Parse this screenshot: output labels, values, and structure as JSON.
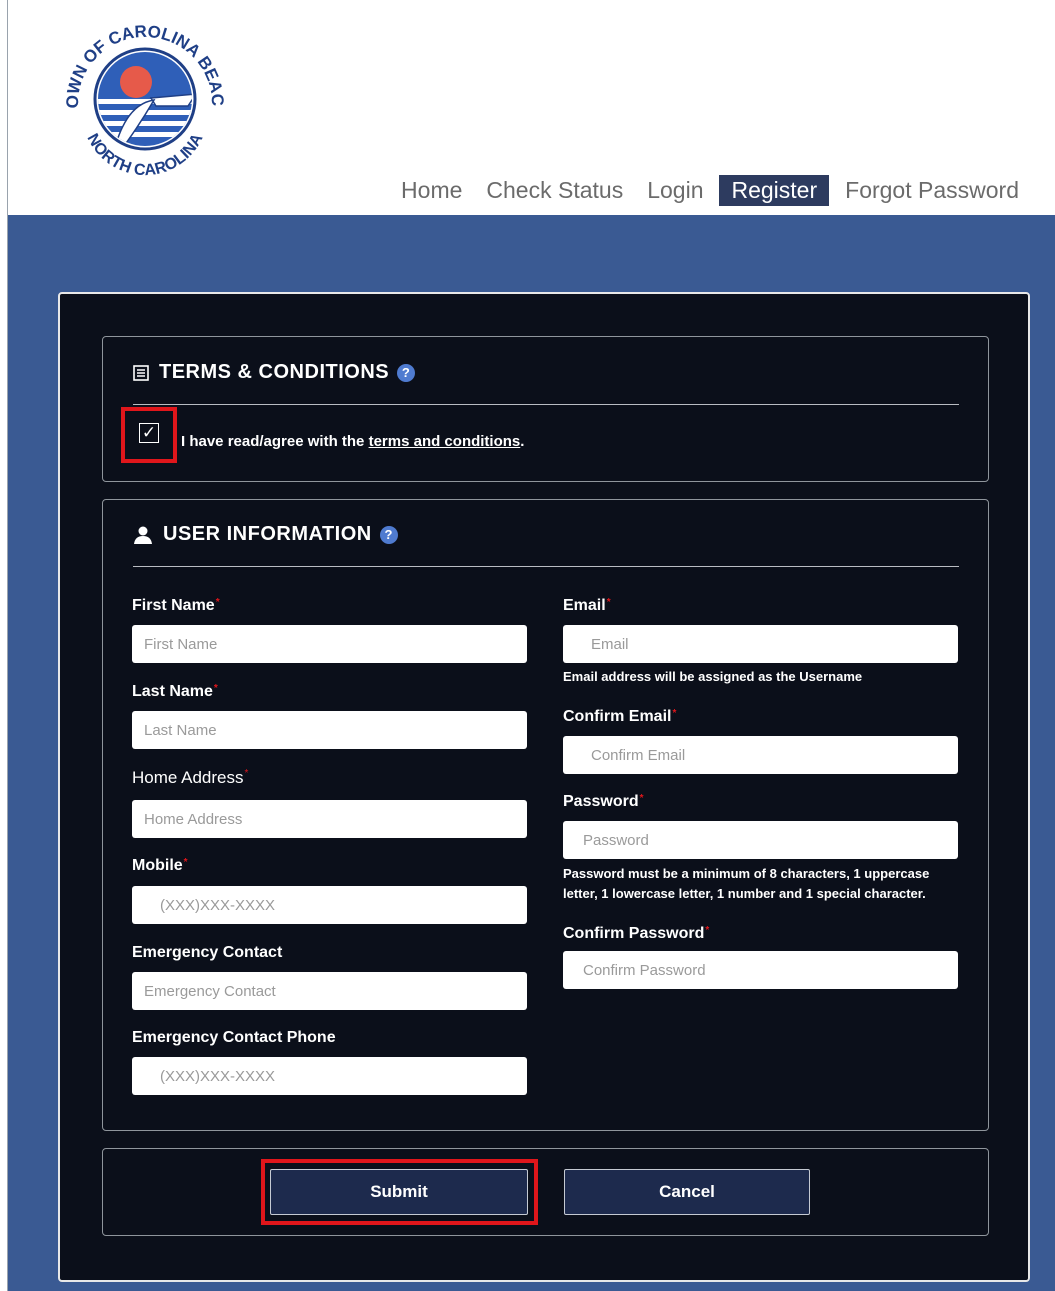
{
  "header": {
    "logo_text": "TOWN OF CAROLINA BEACH NORTH CAROLINA",
    "nav": [
      {
        "label": "Home"
      },
      {
        "label": "Check Status"
      },
      {
        "label": "Login"
      },
      {
        "label": "Register",
        "active": true
      },
      {
        "label": "Forgot Password"
      }
    ]
  },
  "terms": {
    "title": "TERMS & CONDITIONS",
    "checked": true,
    "agree_prefix": "I have read/agree with the",
    "link_text": "terms and conditions",
    "agree_suffix": "."
  },
  "user_info": {
    "title": "USER INFORMATION",
    "required_mark": "*",
    "left": [
      {
        "label": "First Name",
        "required": true,
        "placeholder": "First Name"
      },
      {
        "label": "Last Name",
        "required": true,
        "placeholder": "Last Name"
      },
      {
        "label": "Home Address",
        "required": true,
        "placeholder": "Home Address"
      },
      {
        "label": "Mobile",
        "required": true,
        "placeholder": "(XXX)XXX-XXXX"
      },
      {
        "label": "Emergency Contact",
        "required": false,
        "placeholder": "Emergency Contact"
      },
      {
        "label": "Emergency Contact Phone",
        "required": false,
        "placeholder": "(XXX)XXX-XXXX"
      }
    ],
    "right": [
      {
        "label": "Email",
        "required": true,
        "placeholder": "Email"
      },
      {
        "label": "Confirm Email",
        "required": true,
        "placeholder": "Confirm Email"
      },
      {
        "label": "Password",
        "required": true,
        "placeholder": "Password"
      },
      {
        "label": "Confirm Password",
        "required": true,
        "placeholder": "Confirm Password"
      }
    ],
    "email_hint": "Email address will be assigned as the Username",
    "password_hint_line1": "Password must be a minimum of 8 characters, 1 uppercase",
    "password_hint_line2": "letter, 1 lowercase letter, 1 number and 1 special character."
  },
  "actions": {
    "submit_label": "Submit",
    "cancel_label": "Cancel"
  },
  "colors": {
    "band": "#3a5a93",
    "card": "#0b0f1a",
    "nav_active": "#2d3b5f",
    "highlight": "#e0161b",
    "button": "#1d2a4d"
  }
}
